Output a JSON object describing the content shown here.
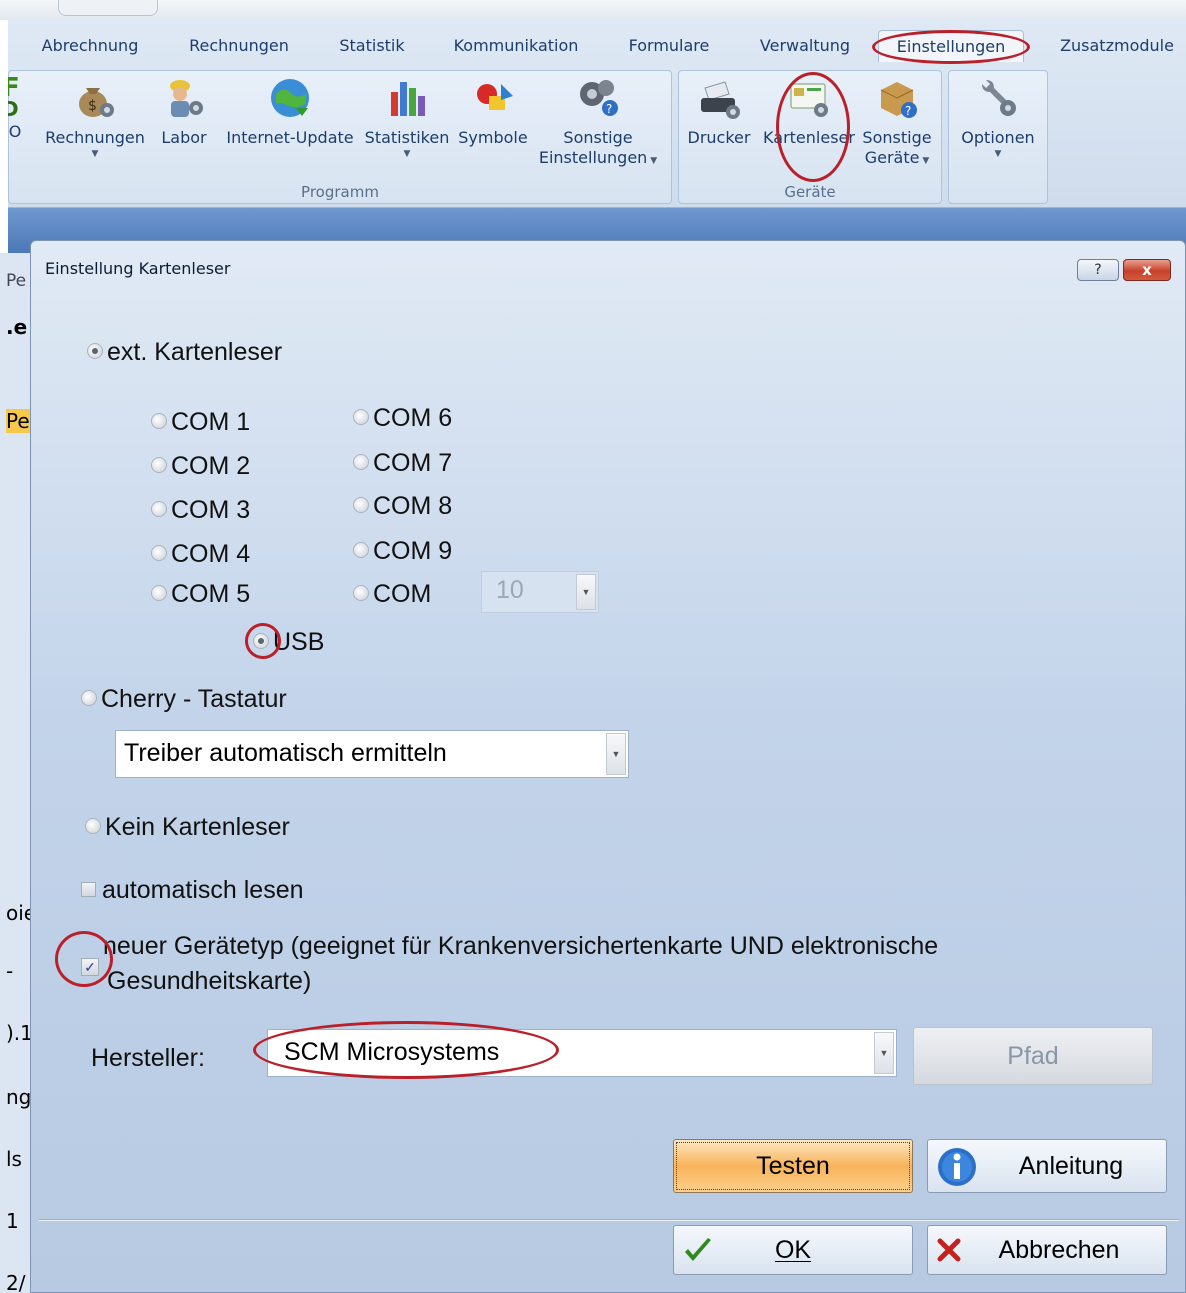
{
  "ribbon": {
    "tabs": [
      "Abrechnung",
      "Rechnungen",
      "Statistik",
      "Kommunikation",
      "Formulare",
      "Verwaltung",
      "Einstellungen",
      "Zusatzmodule"
    ],
    "active_tab": "Einstellungen",
    "groups": {
      "programm": {
        "label": "Programm",
        "buttons": {
          "o": "O",
          "rechnungen": "Rechnungen",
          "labor": "Labor",
          "internet_update": "Internet-Update",
          "statistiken": "Statistiken",
          "symbole": "Symbole",
          "sonstige_einstellungen_1": "Sonstige",
          "sonstige_einstellungen_2": "Einstellungen"
        }
      },
      "geraete": {
        "label": "Geräte",
        "buttons": {
          "drucker": "Drucker",
          "kartenleser": "Kartenleser",
          "sonstige_geraete_1": "Sonstige",
          "sonstige_geraete_2": "Geräte"
        }
      },
      "optionen": {
        "buttons": {
          "optionen": "Optionen"
        }
      }
    }
  },
  "left_strip": [
    "Pe",
    ".e",
    "Pe",
    "oie",
    "-",
    ").1",
    "ng",
    "ls",
    "1",
    "2/"
  ],
  "dialog": {
    "title": "Einstellung Kartenleser",
    "help": "?",
    "close": "x",
    "options": {
      "ext_reader": "ext. Kartenleser",
      "com1": "COM 1",
      "com2": "COM 2",
      "com3": "COM 3",
      "com4": "COM 4",
      "com5": "COM 5",
      "com6": "COM 6",
      "com7": "COM 7",
      "com8": "COM 8",
      "com9": "COM 9",
      "com_custom": "COM",
      "com_custom_value": "10",
      "usb": "USB",
      "cherry": "Cherry - Tastatur",
      "cherry_driver": "Treiber automatisch ermitteln",
      "none": "Kein Kartenleser",
      "auto_read": "automatisch lesen",
      "new_device_1": "neuer Gerätetyp (geeignet für Krankenversichertenkarte UND elektronische",
      "new_device_2": "Gesundheitskarte)"
    },
    "hersteller_label": "Hersteller:",
    "hersteller_value": "SCM Microsystems",
    "buttons": {
      "pfad": "Pfad",
      "testen": "Testen",
      "anleitung": "Anleitung",
      "ok": "OK",
      "abbrechen": "Abbrechen"
    },
    "state": {
      "selected_radio": "ext_reader",
      "selected_port": "usb",
      "auto_read_checked": false,
      "new_device_checked": true
    }
  },
  "colors": {
    "annotation_red": "#b9202a",
    "ribbon_text": "#1e3d6b",
    "default_button": "#f8b35a"
  }
}
